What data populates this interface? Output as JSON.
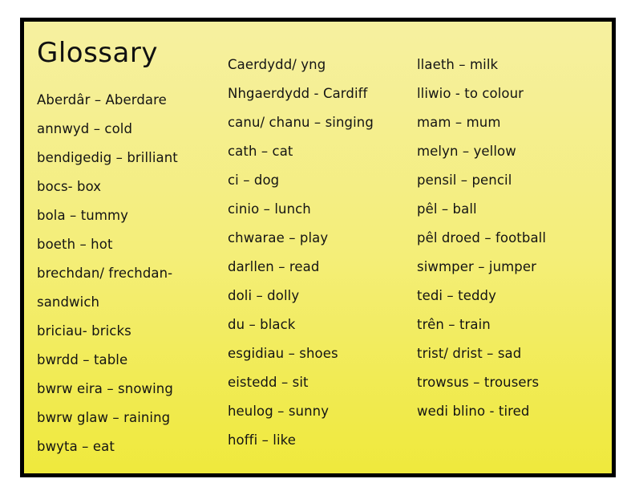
{
  "slide": {
    "title": "Glossary",
    "background": {
      "gradient_top": "#f6f0a0",
      "gradient_mid": "#f4ee78",
      "gradient_bottom": "#efe93c",
      "border_color": "#000000"
    },
    "text_color": "#141414"
  },
  "columns": [
    {
      "id": "column-1",
      "entries": [
        "Aberdâr – Aberdare",
        "annwyd – cold",
        "bendigedig – brilliant",
        "bocs- box",
        "bola – tummy",
        "boeth – hot",
        "brechdan/ frechdan-",
        "sandwich",
        "briciau- bricks",
        "bwrdd – table",
        "bwrw eira – snowing",
        "bwrw glaw – raining",
        "bwyta – eat"
      ]
    },
    {
      "id": "column-2",
      "entries": [
        "Caerdydd/ yng",
        "Nhgaerdydd - Cardiff",
        "canu/ chanu – singing",
        "cath – cat",
        "ci – dog",
        "cinio – lunch",
        "chwarae – play",
        "darllen – read",
        "doli – dolly",
        "du – black",
        "esgidiau – shoes",
        "eistedd – sit",
        "heulog – sunny",
        "hoffi – like"
      ]
    },
    {
      "id": "column-3",
      "entries": [
        "llaeth – milk",
        "lliwio -  to colour",
        "mam – mum",
        "melyn – yellow",
        "pensil – pencil",
        "pêl – ball",
        "pêl droed – football",
        "siwmper – jumper",
        "tedi – teddy",
        "trên – train",
        "trist/ drist – sad",
        "trowsus – trousers",
        "wedi blino - tired"
      ]
    }
  ]
}
